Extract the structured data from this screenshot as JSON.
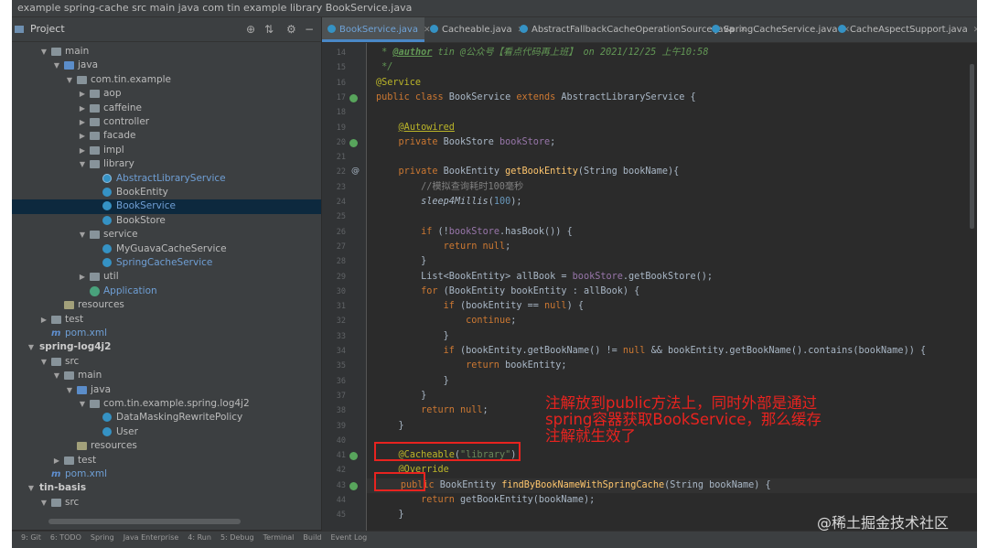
{
  "topbar": {
    "path": "example  spring-cache  src  main  java  com  tin  example  library  BookService.java"
  },
  "project": {
    "title": "Project",
    "tree": [
      {
        "label": "main",
        "type": "folder",
        "depth": 1,
        "arrow": "down"
      },
      {
        "label": "java",
        "type": "folder-blue",
        "depth": 2,
        "arrow": "down"
      },
      {
        "label": "com.tin.example",
        "type": "folder",
        "depth": 3,
        "arrow": "down"
      },
      {
        "label": "aop",
        "type": "folder",
        "depth": 4,
        "arrow": "right"
      },
      {
        "label": "caffeine",
        "type": "folder",
        "depth": 4,
        "arrow": "right"
      },
      {
        "label": "controller",
        "type": "folder",
        "depth": 4,
        "arrow": "right"
      },
      {
        "label": "facade",
        "type": "folder",
        "depth": 4,
        "arrow": "right"
      },
      {
        "label": "impl",
        "type": "folder",
        "depth": 4,
        "arrow": "right"
      },
      {
        "label": "library",
        "type": "folder",
        "depth": 4,
        "arrow": "down"
      },
      {
        "label": "AbstractLibraryService",
        "type": "cls-abs",
        "depth": 5,
        "color": "blue"
      },
      {
        "label": "BookEntity",
        "type": "cls",
        "depth": 5
      },
      {
        "label": "BookService",
        "type": "cls",
        "depth": 5,
        "selected": true,
        "color": "blue"
      },
      {
        "label": "BookStore",
        "type": "cls",
        "depth": 5
      },
      {
        "label": "service",
        "type": "folder",
        "depth": 4,
        "arrow": "down"
      },
      {
        "label": "MyGuavaCacheService",
        "type": "cls",
        "depth": 5
      },
      {
        "label": "SpringCacheService",
        "type": "cls",
        "depth": 5,
        "color": "blue"
      },
      {
        "label": "util",
        "type": "folder",
        "depth": 4,
        "arrow": "right"
      },
      {
        "label": "Application",
        "type": "app",
        "depth": 4,
        "color": "blue"
      },
      {
        "label": "resources",
        "type": "folder-res",
        "depth": 2
      },
      {
        "label": "test",
        "type": "folder",
        "depth": 1,
        "arrow": "right"
      },
      {
        "label": "pom.xml",
        "type": "mvn",
        "depth": 1,
        "color": "blue"
      },
      {
        "label": "spring-log4j2",
        "type": "module",
        "depth": 0,
        "arrow": "down",
        "bold": true
      },
      {
        "label": "src",
        "type": "folder",
        "depth": 1,
        "arrow": "down"
      },
      {
        "label": "main",
        "type": "folder",
        "depth": 2,
        "arrow": "down"
      },
      {
        "label": "java",
        "type": "folder-blue",
        "depth": 3,
        "arrow": "down"
      },
      {
        "label": "com.tin.example.spring.log4j2",
        "type": "folder",
        "depth": 4,
        "arrow": "down"
      },
      {
        "label": "DataMaskingRewritePolicy",
        "type": "cls",
        "depth": 5
      },
      {
        "label": "User",
        "type": "cls",
        "depth": 5
      },
      {
        "label": "resources",
        "type": "folder-res",
        "depth": 3
      },
      {
        "label": "test",
        "type": "folder",
        "depth": 2,
        "arrow": "right"
      },
      {
        "label": "pom.xml",
        "type": "mvn",
        "depth": 1,
        "color": "blue"
      },
      {
        "label": "tin-basis",
        "type": "module",
        "depth": 0,
        "arrow": "down",
        "bold": true
      },
      {
        "label": "src",
        "type": "folder",
        "depth": 1,
        "arrow": "down"
      }
    ]
  },
  "tabs": [
    {
      "label": "BookService.java",
      "active": true
    },
    {
      "label": "Cacheable.java"
    },
    {
      "label": "AbstractFallbackCacheOperationSource.java"
    },
    {
      "label": "SpringCacheService.java"
    },
    {
      "label": "CacheAspectSupport.java"
    }
  ],
  "editor": {
    "line_numbers": [
      "14",
      "15",
      "16",
      "17",
      "18",
      "19",
      "20",
      "21",
      "22",
      "23",
      "24",
      "25",
      "26",
      "27",
      "28",
      "29",
      "30",
      "31",
      "32",
      "33",
      "34",
      "35",
      "36",
      "37",
      "38",
      "39",
      "40",
      "41",
      "42",
      "43",
      "44",
      "45"
    ],
    "lines": [
      {
        "ln": "14",
        "html": " <span class=\"cm\">* </span><span class=\"tagauthor\">@author</span><span class=\"cm\"> tin @公众号【看点代码再上班】 on 2021/12/25 上午10:58</span>"
      },
      {
        "ln": "15",
        "html": " <span class=\"cm\">*/</span>"
      },
      {
        "ln": "16",
        "html": "<span class=\"an\">@Service</span>"
      },
      {
        "ln": "17",
        "html": "<span class=\"kw\">public class </span>BookService <span class=\"kw\">extends </span>AbstractLibraryService {"
      },
      {
        "ln": "18",
        "html": ""
      },
      {
        "ln": "19",
        "html": "    <span class=\"anu\">@Autowired</span>"
      },
      {
        "ln": "20",
        "html": "    <span class=\"kw\">private </span>BookStore <span class=\"fld\">bookStore</span>;"
      },
      {
        "ln": "21",
        "html": ""
      },
      {
        "ln": "22",
        "html": "    <span class=\"kw\">private </span>BookEntity <span class=\"fn\">getBookEntity</span>(String bookName){"
      },
      {
        "ln": "23",
        "html": "        <span class=\"cmt\">//模拟查询耗时100毫秒</span>"
      },
      {
        "ln": "24",
        "html": "        <span class=\"it\">sleep4Millis</span>(<span class=\"num\">100</span>);"
      },
      {
        "ln": "25",
        "html": ""
      },
      {
        "ln": "26",
        "html": "        <span class=\"kw\">if </span>(!<span class=\"fld\">bookStore</span>.hasBook()) {"
      },
      {
        "ln": "27",
        "html": "            <span class=\"kw\">return null</span>;"
      },
      {
        "ln": "28",
        "html": "        }"
      },
      {
        "ln": "29",
        "html": "        List&lt;BookEntity&gt; allBook = <span class=\"fld\">bookStore</span>.getBookStore();"
      },
      {
        "ln": "30",
        "html": "        <span class=\"kw\">for </span>(BookEntity bookEntity : allBook) {"
      },
      {
        "ln": "31",
        "html": "            <span class=\"kw\">if </span>(bookEntity == <span class=\"kw\">null</span>) {"
      },
      {
        "ln": "32",
        "html": "                <span class=\"kw\">continue</span>;"
      },
      {
        "ln": "33",
        "html": "            }"
      },
      {
        "ln": "34",
        "html": "            <span class=\"kw\">if </span>(bookEntity.getBookName() != <span class=\"kw\">null </span>&amp;&amp; bookEntity.getBookName().contains(bookName)) {"
      },
      {
        "ln": "35",
        "html": "                <span class=\"kw\">return </span>bookEntity;"
      },
      {
        "ln": "36",
        "html": "            }"
      },
      {
        "ln": "37",
        "html": "        }"
      },
      {
        "ln": "38",
        "html": "        <span class=\"kw\">return null</span>;"
      },
      {
        "ln": "39",
        "html": "    }"
      },
      {
        "ln": "40",
        "html": ""
      },
      {
        "ln": "41",
        "html": "    <span class=\"an\">@Cacheable</span>(<span class=\"str\">\"library\"</span>)"
      },
      {
        "ln": "42",
        "html": "    <span class=\"an\">@Override</span>"
      },
      {
        "ln": "43",
        "html": "    <span class=\"kw\">public </span>BookEntity <span class=\"fn\">findByBookNameWithSpringCache</span>(String bookName) {",
        "current": true
      },
      {
        "ln": "44",
        "html": "        <span class=\"kw\">return </span>getBookEntity(bookName);"
      },
      {
        "ln": "45",
        "html": "    }"
      }
    ]
  },
  "annotation": {
    "line1": "注解放到public方法上，同时外部是通过",
    "line2": "spring容器获取BookService，那么缓存",
    "line3": "注解就生效了"
  },
  "statusbar": {
    "items": [
      "9: Git",
      "6: TODO",
      "Spring",
      "Java Enterprise",
      "4: Run",
      "5: Debug",
      "Terminal",
      "Build",
      "Event Log"
    ]
  },
  "watermark": "@稀土掘金技术社区"
}
